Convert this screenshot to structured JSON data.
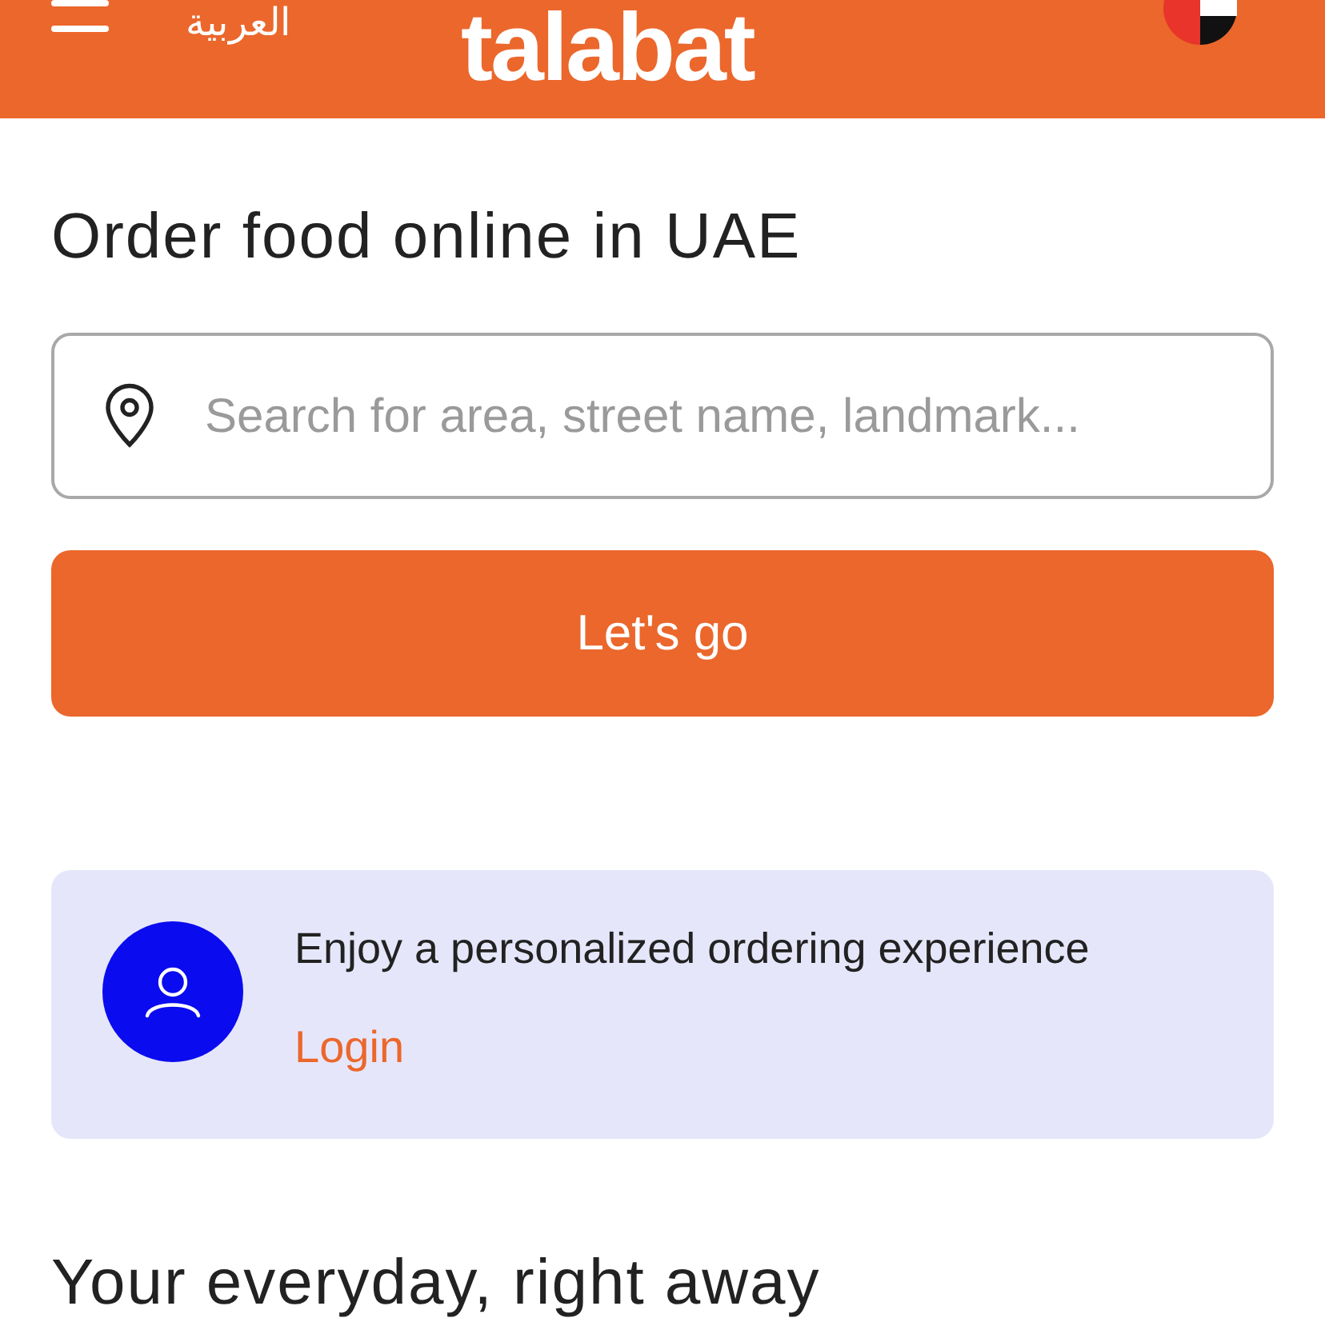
{
  "header": {
    "language": "العربية",
    "logo": "talabat"
  },
  "title": "Order food online in UAE",
  "search": {
    "placeholder": "Search for area, street name, landmark..."
  },
  "button": "Let's go",
  "login_card": {
    "text": "Enjoy a personalized ordering experience",
    "link": "Login"
  },
  "section_title": "Your everyday, right away"
}
